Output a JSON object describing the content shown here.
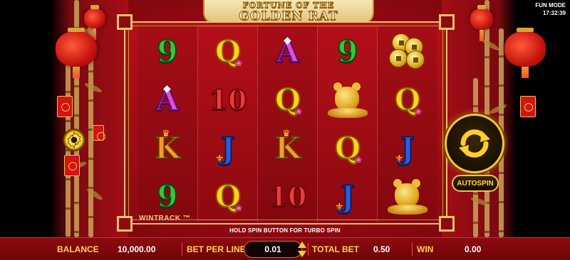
{
  "game": {
    "title_line1": "FORTUNE OF THE",
    "title_line2": "GOLDEN RAT"
  },
  "status": {
    "mode": "FUN MODE",
    "time": "17:32:39"
  },
  "reels": [
    [
      "9",
      "A",
      "K",
      "9"
    ],
    [
      "Q",
      "10",
      "J",
      "Q"
    ],
    [
      "A",
      "Q",
      "K",
      "10"
    ],
    [
      "9",
      "rat",
      "Q",
      "J"
    ],
    [
      "coins",
      "Q",
      "J",
      "rat"
    ]
  ],
  "wintrack_label": "WINTRACK ™",
  "turbo_hint": "HOLD SPIN BUTTON FOR TURBO SPIN",
  "autospin_label": "AUTOSPIN",
  "bottom_bar": {
    "balance_label": "BALANCE",
    "balance_value": "10,000.00",
    "bet_per_line_label": "BET PER LINE",
    "bet_per_line_value": "0.01",
    "total_bet_label": "TOTAL BET",
    "total_bet_value": "0.50",
    "win_label": "WIN",
    "win_value": "0.00"
  },
  "colors": {
    "accent_gold": "#f4c43a",
    "background_red": "#9a0a12"
  }
}
